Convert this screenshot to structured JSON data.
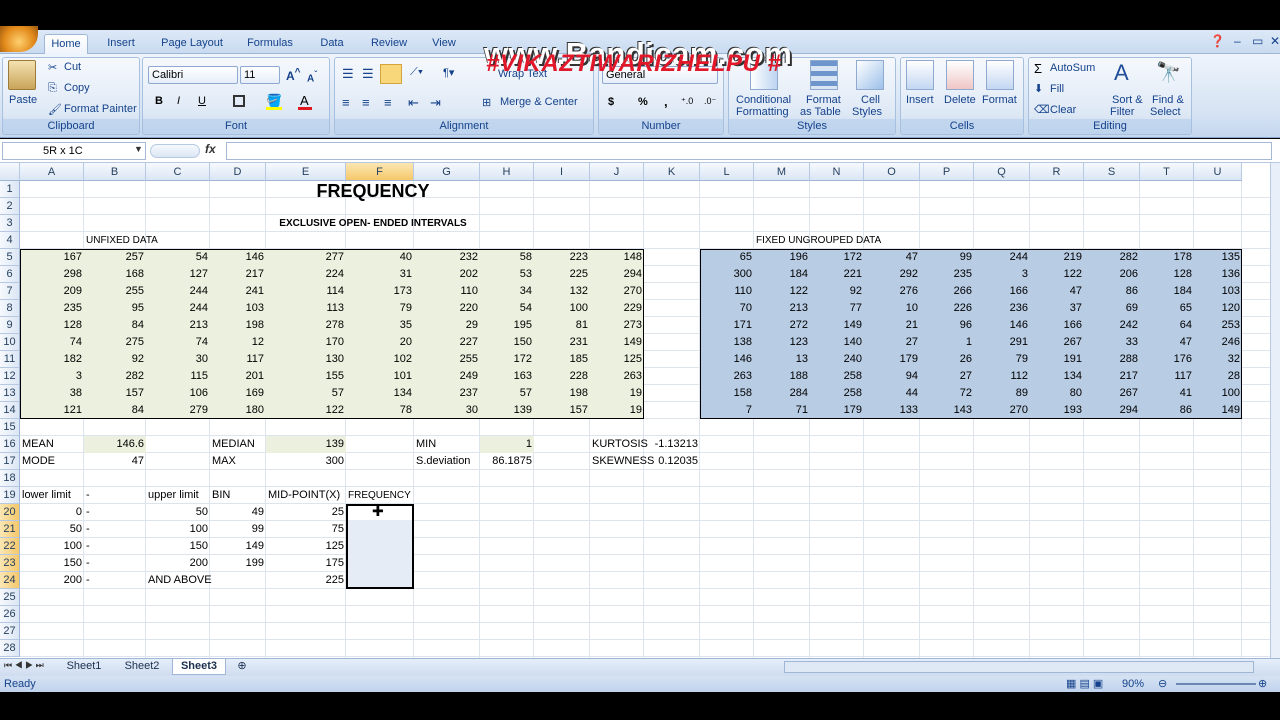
{
  "watermark": "www.Bandicam.com",
  "watermark_sub": "#VIKAZTIWARIZHELPU #",
  "ribbon": {
    "tabs": [
      "Home",
      "Insert",
      "Page Layout",
      "Formulas",
      "Data",
      "Review",
      "View"
    ],
    "clipboard": {
      "label": "Clipboard",
      "paste": "Paste",
      "cut": "Cut",
      "copy": "Copy",
      "format_painter": "Format Painter"
    },
    "font": {
      "label": "Font",
      "name": "Calibri",
      "size": "11"
    },
    "alignment": {
      "label": "Alignment",
      "wrap": "Wrap Text",
      "merge": "Merge & Center"
    },
    "number": {
      "label": "Number",
      "format": "General",
      "currency": "$",
      "percent": "%",
      "comma": ","
    },
    "styles": {
      "label": "Styles",
      "conditional": "Conditional",
      "conditional2": "Formatting",
      "format_table": "Format",
      "format_table2": "as Table",
      "cell_styles": "Cell",
      "cell_styles2": "Styles"
    },
    "cells": {
      "label": "Cells",
      "insert": "Insert",
      "delete": "Delete",
      "format": "Format"
    },
    "editing": {
      "label": "Editing",
      "autosum": "AutoSum",
      "fill": "Fill",
      "clear": "Clear",
      "sort": "Sort &",
      "sort2": "Filter",
      "find": "Find &",
      "find2": "Select"
    }
  },
  "formula_bar": {
    "name_box": "5R x 1C",
    "fx": "fx",
    "value": ""
  },
  "columns": [
    "A",
    "B",
    "C",
    "D",
    "E",
    "F",
    "G",
    "H",
    "I",
    "J",
    "K",
    "L",
    "M",
    "N",
    "O",
    "P",
    "Q",
    "R",
    "S",
    "T",
    "U"
  ],
  "rows": [
    "1",
    "2",
    "3",
    "4",
    "5",
    "6",
    "7",
    "8",
    "9",
    "10",
    "11",
    "12",
    "13",
    "14",
    "15",
    "16",
    "17",
    "18",
    "19",
    "20",
    "21",
    "22",
    "23",
    "24",
    "25",
    "26",
    "27",
    "28"
  ],
  "sheet": {
    "title": "FREQUENCY",
    "subtitle": "EXCLUSIVE OPEN- ENDED INTERVALS",
    "unfixed_label": "UNFIXED DATA",
    "fixed_label": "FIXED UNGROUPED DATA",
    "unfixed": [
      [
        "167",
        "257",
        "54",
        "146",
        "277",
        "40",
        "232",
        "58",
        "223",
        "148"
      ],
      [
        "298",
        "168",
        "127",
        "217",
        "224",
        "31",
        "202",
        "53",
        "225",
        "294"
      ],
      [
        "209",
        "255",
        "244",
        "241",
        "114",
        "173",
        "110",
        "34",
        "132",
        "270"
      ],
      [
        "235",
        "95",
        "244",
        "103",
        "113",
        "79",
        "220",
        "54",
        "100",
        "229"
      ],
      [
        "128",
        "84",
        "213",
        "198",
        "278",
        "35",
        "29",
        "195",
        "81",
        "273"
      ],
      [
        "74",
        "275",
        "74",
        "12",
        "170",
        "20",
        "227",
        "150",
        "231",
        "149"
      ],
      [
        "182",
        "92",
        "30",
        "117",
        "130",
        "102",
        "255",
        "172",
        "185",
        "125"
      ],
      [
        "3",
        "282",
        "115",
        "201",
        "155",
        "101",
        "249",
        "163",
        "228",
        "263"
      ],
      [
        "38",
        "157",
        "106",
        "169",
        "57",
        "134",
        "237",
        "57",
        "198",
        "19"
      ],
      [
        "121",
        "84",
        "279",
        "180",
        "122",
        "78",
        "30",
        "139",
        "157",
        "19"
      ]
    ],
    "fixed": [
      [
        "65",
        "196",
        "172",
        "47",
        "99",
        "244",
        "219",
        "282",
        "178",
        "135"
      ],
      [
        "300",
        "184",
        "221",
        "292",
        "235",
        "3",
        "122",
        "206",
        "128",
        "136"
      ],
      [
        "110",
        "122",
        "92",
        "276",
        "266",
        "166",
        "47",
        "86",
        "184",
        "103"
      ],
      [
        "70",
        "213",
        "77",
        "10",
        "226",
        "236",
        "37",
        "69",
        "65",
        "120"
      ],
      [
        "171",
        "272",
        "149",
        "21",
        "96",
        "146",
        "166",
        "242",
        "64",
        "253"
      ],
      [
        "138",
        "123",
        "140",
        "27",
        "1",
        "291",
        "267",
        "33",
        "47",
        "246"
      ],
      [
        "146",
        "13",
        "240",
        "179",
        "26",
        "79",
        "191",
        "288",
        "176",
        "32"
      ],
      [
        "263",
        "188",
        "258",
        "94",
        "27",
        "112",
        "134",
        "217",
        "117",
        "28"
      ],
      [
        "158",
        "284",
        "258",
        "44",
        "72",
        "89",
        "80",
        "267",
        "41",
        "100"
      ],
      [
        "7",
        "71",
        "179",
        "133",
        "143",
        "270",
        "193",
        "294",
        "86",
        "149"
      ]
    ],
    "stats": {
      "mean_label": "MEAN",
      "mean": "146.6",
      "median_label": "MEDIAN",
      "median": "139",
      "min_label": "MIN",
      "min": "1",
      "kurtosis_label": "KURTOSIS",
      "kurtosis": "-1.13213",
      "mode_label": "MODE",
      "mode": "47",
      "max_label": "MAX",
      "max": "300",
      "sd_label": "S.deviation",
      "sd": "86.1875",
      "skewness_label": "SKEWNESS",
      "skewness": "0.12035"
    },
    "freq_headers": {
      "lower": "lower limit",
      "dash": "-",
      "upper": "upper limit",
      "bin": "BIN",
      "mid": "MID-POINT(X)",
      "freq": "FREQUENCY"
    },
    "freq_rows": [
      {
        "lower": "0",
        "dash": "-",
        "upper": "50",
        "bin": "49",
        "mid": "25"
      },
      {
        "lower": "50",
        "dash": "-",
        "upper": "100",
        "bin": "99",
        "mid": "75"
      },
      {
        "lower": "100",
        "dash": "-",
        "upper": "150",
        "bin": "149",
        "mid": "125"
      },
      {
        "lower": "150",
        "dash": "-",
        "upper": "200",
        "bin": "199",
        "mid": "175"
      },
      {
        "lower": "200",
        "dash": "-",
        "upper": "AND ABOVE",
        "bin": "",
        "mid": "225"
      }
    ]
  },
  "sheet_tabs": [
    "Sheet1",
    "Sheet2",
    "Sheet3"
  ],
  "status": {
    "ready": "Ready",
    "zoom": "90%"
  },
  "colors": {
    "unfixed_fill": "#ebf1de",
    "fixed_fill": "#b8cce4",
    "selection_fill": "#e6ecf5"
  }
}
